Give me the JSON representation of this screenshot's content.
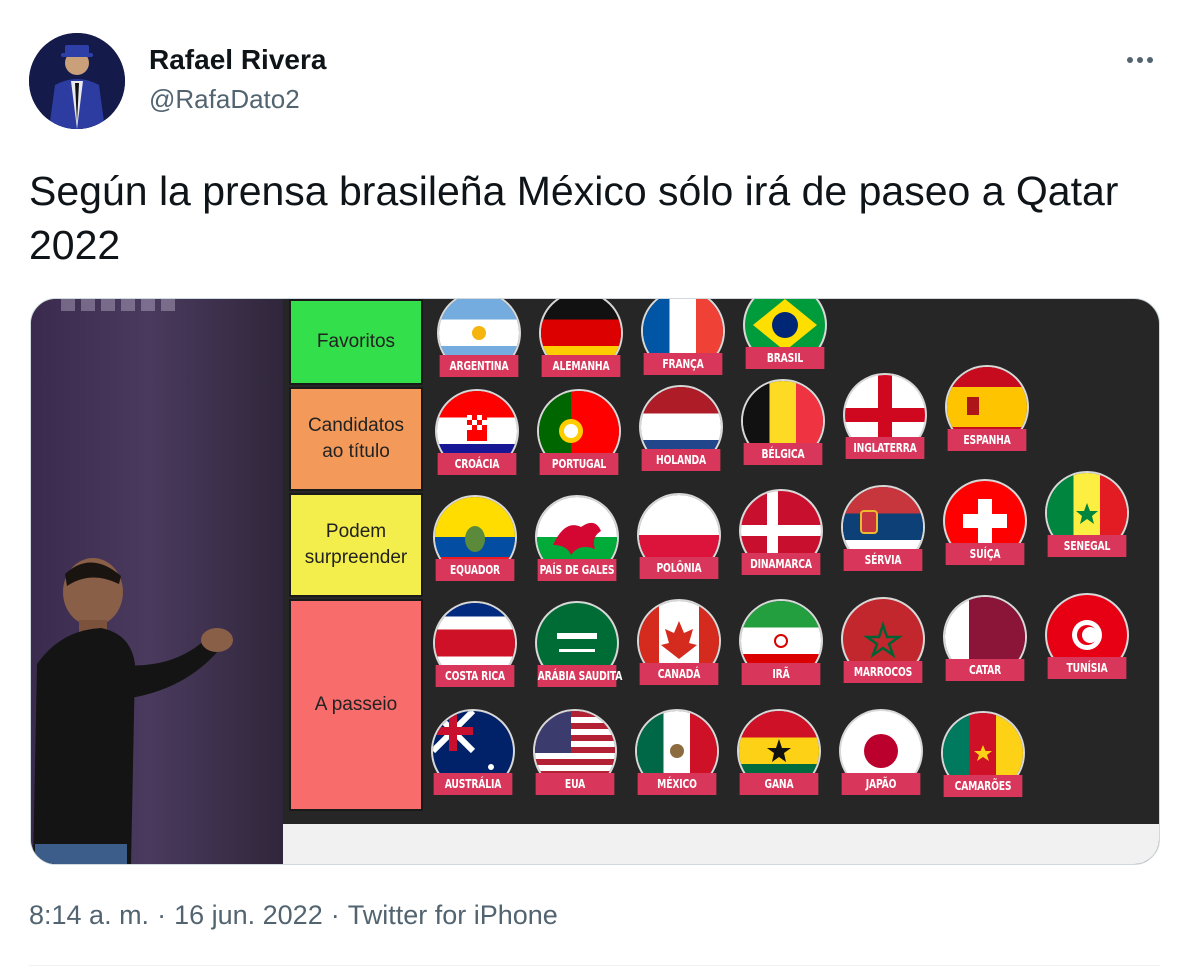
{
  "author": {
    "display_name": "Rafael Rivera",
    "handle": "@RafaDato2"
  },
  "tweet": {
    "text": "Según la prensa brasileña México sólo irá de paseo a Qatar 2022"
  },
  "media": {
    "tiers": [
      {
        "label": "Favoritos",
        "color": "#33e04b"
      },
      {
        "label": "Candidatos ao título",
        "color": "#f39a5a"
      },
      {
        "label": "Podem surpreender",
        "color": "#f4ee4c"
      },
      {
        "label": "A passeio",
        "color": "#f86c6c"
      }
    ],
    "rows": [
      [
        "ARGENTINA",
        "ALEMANHA",
        "FRANÇA",
        "BRASIL"
      ],
      [
        "CROÁCIA",
        "PORTUGAL",
        "HOLANDA",
        "BÉLGICA",
        "INGLATERRA",
        "ESPANHA"
      ],
      [
        "EQUADOR",
        "PAÍS DE GALES",
        "POLÔNIA",
        "DINAMARCA",
        "SÉRVIA",
        "SUÍÇA",
        "SENEGAL"
      ],
      [
        "COSTA RICA",
        "ARÁBIA SAUDITA",
        "CANADÁ",
        "IRÃ",
        "MARROCOS",
        "CATAR",
        "TUNÍSIA"
      ],
      [
        "AUSTRÁLIA",
        "EUA",
        "MÉXICO",
        "GANA",
        "JAPÃO",
        "CAMARÕES"
      ]
    ]
  },
  "meta": {
    "time": "8:14 a. m.",
    "date": "16 jun. 2022",
    "source": "Twitter for iPhone",
    "separator": "·"
  },
  "icons": {
    "more": "more-horizontal-icon"
  },
  "colors": {
    "label_bg": "#d8365a",
    "secondary_text": "#536471"
  }
}
